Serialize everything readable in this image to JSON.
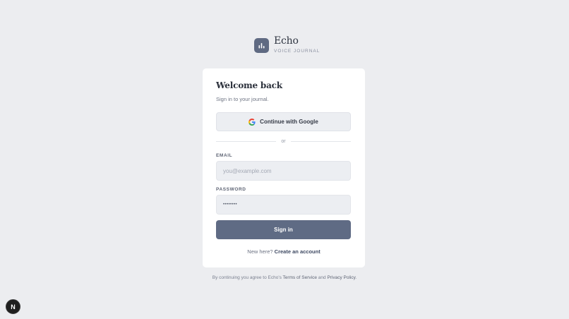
{
  "brand": {
    "name": "Echo",
    "tagline": "VOICE JOURNAL",
    "accent_color": "#5f6a82",
    "logo_icon": "bar-chart-icon"
  },
  "card": {
    "title": "Welcome back",
    "subtitle": "Sign in to your journal.",
    "google_button": {
      "label": "Continue with Google",
      "icon": "google-icon"
    },
    "divider_text": "or",
    "email": {
      "label": "EMAIL",
      "placeholder": "you@example.com",
      "value": ""
    },
    "password": {
      "label": "PASSWORD",
      "masked_value": "••••••••"
    },
    "signin_button": {
      "label": "Sign in",
      "color": "#5f6b84"
    },
    "signup": {
      "prompt": "New here?",
      "link_label": "Create an account"
    }
  },
  "footer": {
    "prefix": "By continuing you agree to Echo's",
    "terms": "Terms of Service",
    "and": "and",
    "privacy": "Privacy Policy",
    "suffix": "."
  },
  "dev_badge": {
    "label": "N",
    "icon": "nextjs-icon"
  }
}
